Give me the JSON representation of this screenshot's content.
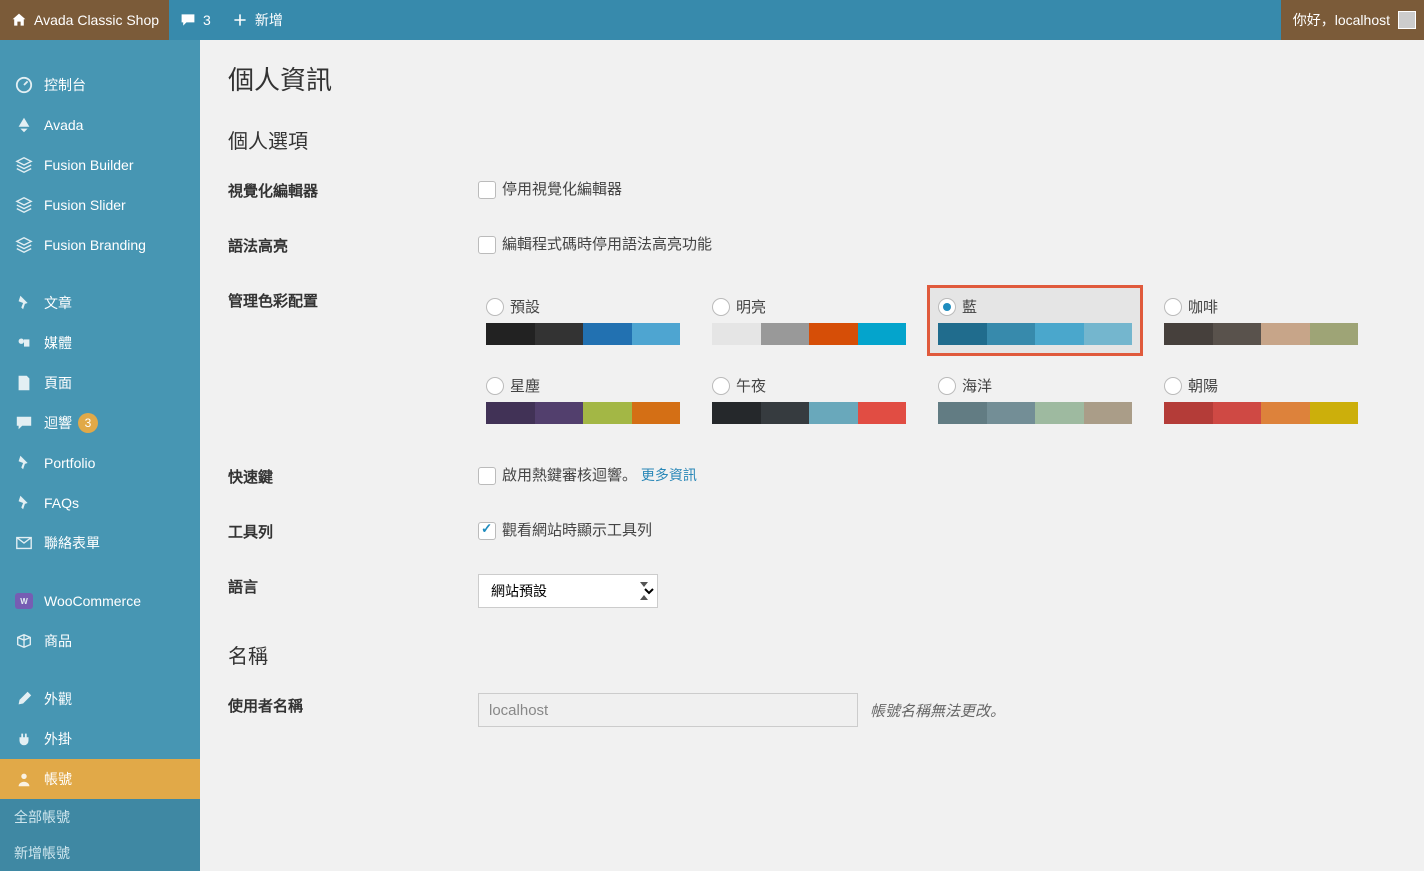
{
  "adminbar": {
    "site_name": "Avada Classic Shop",
    "comments_count": "3",
    "add_new": "新增",
    "greeting": "你好，localhost"
  },
  "sidebar": {
    "items": [
      {
        "label": "控制台"
      },
      {
        "label": "Avada"
      },
      {
        "label": "Fusion Builder"
      },
      {
        "label": "Fusion Slider"
      },
      {
        "label": "Fusion Branding"
      },
      {
        "label": "文章"
      },
      {
        "label": "媒體"
      },
      {
        "label": "頁面"
      },
      {
        "label": "迴響",
        "badge": "3"
      },
      {
        "label": "Portfolio"
      },
      {
        "label": "FAQs"
      },
      {
        "label": "聯絡表單"
      },
      {
        "label": "WooCommerce"
      },
      {
        "label": "商品"
      },
      {
        "label": "外觀"
      },
      {
        "label": "外掛"
      },
      {
        "label": "帳號"
      }
    ],
    "sub": [
      {
        "label": "全部帳號"
      },
      {
        "label": "新增帳號"
      }
    ]
  },
  "page": {
    "title": "個人資訊",
    "section_options": "個人選項",
    "row_visual_editor": "視覺化編輯器",
    "cb_disable_visual_editor": "停用視覺化編輯器",
    "row_syntax": "語法高亮",
    "cb_disable_syntax": "編輯程式碼時停用語法高亮功能",
    "row_color_scheme": "管理色彩配置",
    "schemes": [
      {
        "label": "預設",
        "selected": false,
        "colors": [
          "#222222",
          "#333333",
          "#2271b1",
          "#4ea5d1"
        ]
      },
      {
        "label": "明亮",
        "selected": false,
        "colors": [
          "#e5e5e5",
          "#999999",
          "#d64e07",
          "#04a4cc"
        ]
      },
      {
        "label": "藍",
        "selected": true,
        "colors": [
          "#206c8d",
          "#378aac",
          "#4aa7cc",
          "#74b6ce"
        ]
      },
      {
        "label": "咖啡",
        "selected": false,
        "colors": [
          "#46403c",
          "#59524c",
          "#c7a589",
          "#9ea476"
        ]
      },
      {
        "label": "星塵",
        "selected": false,
        "colors": [
          "#413256",
          "#523f6d",
          "#a3b745",
          "#d46f15"
        ]
      },
      {
        "label": "午夜",
        "selected": false,
        "colors": [
          "#25282b",
          "#363b3f",
          "#69a8bb",
          "#e14d43"
        ]
      },
      {
        "label": "海洋",
        "selected": false,
        "colors": [
          "#627c83",
          "#738e96",
          "#9ebaa0",
          "#aa9d88"
        ]
      },
      {
        "label": "朝陽",
        "selected": false,
        "colors": [
          "#b43c38",
          "#cf4944",
          "#dd823b",
          "#ccaf0b"
        ]
      }
    ],
    "row_hotkeys": "快速鍵",
    "cb_hotkeys": "啟用熱鍵審核迴響。",
    "link_more_info": "更多資訊",
    "row_toolbar": "工具列",
    "cb_toolbar": "觀看網站時顯示工具列",
    "row_language": "語言",
    "language_value": "網站預設",
    "section_name": "名稱",
    "row_username": "使用者名稱",
    "username_value": "localhost",
    "username_note": "帳號名稱無法更改。"
  }
}
